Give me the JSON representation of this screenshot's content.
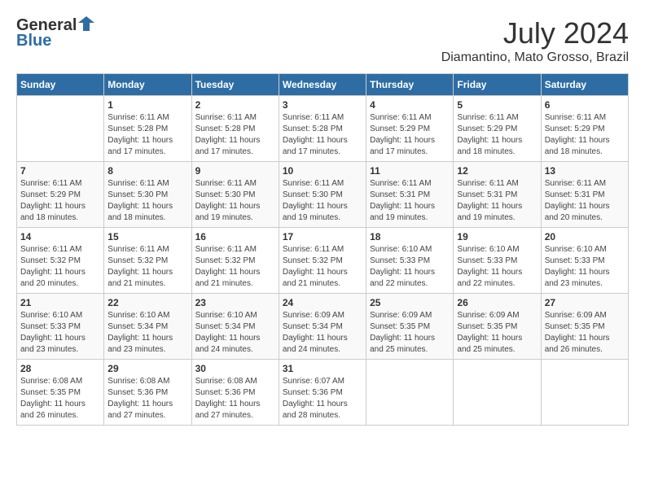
{
  "header": {
    "logo_general": "General",
    "logo_blue": "Blue",
    "month": "July 2024",
    "location": "Diamantino, Mato Grosso, Brazil"
  },
  "days_of_week": [
    "Sunday",
    "Monday",
    "Tuesday",
    "Wednesday",
    "Thursday",
    "Friday",
    "Saturday"
  ],
  "weeks": [
    [
      {
        "day": "",
        "info": ""
      },
      {
        "day": "1",
        "info": "Sunrise: 6:11 AM\nSunset: 5:28 PM\nDaylight: 11 hours\nand 17 minutes."
      },
      {
        "day": "2",
        "info": "Sunrise: 6:11 AM\nSunset: 5:28 PM\nDaylight: 11 hours\nand 17 minutes."
      },
      {
        "day": "3",
        "info": "Sunrise: 6:11 AM\nSunset: 5:28 PM\nDaylight: 11 hours\nand 17 minutes."
      },
      {
        "day": "4",
        "info": "Sunrise: 6:11 AM\nSunset: 5:29 PM\nDaylight: 11 hours\nand 17 minutes."
      },
      {
        "day": "5",
        "info": "Sunrise: 6:11 AM\nSunset: 5:29 PM\nDaylight: 11 hours\nand 18 minutes."
      },
      {
        "day": "6",
        "info": "Sunrise: 6:11 AM\nSunset: 5:29 PM\nDaylight: 11 hours\nand 18 minutes."
      }
    ],
    [
      {
        "day": "7",
        "info": "Sunrise: 6:11 AM\nSunset: 5:29 PM\nDaylight: 11 hours\nand 18 minutes."
      },
      {
        "day": "8",
        "info": "Sunrise: 6:11 AM\nSunset: 5:30 PM\nDaylight: 11 hours\nand 18 minutes."
      },
      {
        "day": "9",
        "info": "Sunrise: 6:11 AM\nSunset: 5:30 PM\nDaylight: 11 hours\nand 19 minutes."
      },
      {
        "day": "10",
        "info": "Sunrise: 6:11 AM\nSunset: 5:30 PM\nDaylight: 11 hours\nand 19 minutes."
      },
      {
        "day": "11",
        "info": "Sunrise: 6:11 AM\nSunset: 5:31 PM\nDaylight: 11 hours\nand 19 minutes."
      },
      {
        "day": "12",
        "info": "Sunrise: 6:11 AM\nSunset: 5:31 PM\nDaylight: 11 hours\nand 19 minutes."
      },
      {
        "day": "13",
        "info": "Sunrise: 6:11 AM\nSunset: 5:31 PM\nDaylight: 11 hours\nand 20 minutes."
      }
    ],
    [
      {
        "day": "14",
        "info": "Sunrise: 6:11 AM\nSunset: 5:32 PM\nDaylight: 11 hours\nand 20 minutes."
      },
      {
        "day": "15",
        "info": "Sunrise: 6:11 AM\nSunset: 5:32 PM\nDaylight: 11 hours\nand 21 minutes."
      },
      {
        "day": "16",
        "info": "Sunrise: 6:11 AM\nSunset: 5:32 PM\nDaylight: 11 hours\nand 21 minutes."
      },
      {
        "day": "17",
        "info": "Sunrise: 6:11 AM\nSunset: 5:32 PM\nDaylight: 11 hours\nand 21 minutes."
      },
      {
        "day": "18",
        "info": "Sunrise: 6:10 AM\nSunset: 5:33 PM\nDaylight: 11 hours\nand 22 minutes."
      },
      {
        "day": "19",
        "info": "Sunrise: 6:10 AM\nSunset: 5:33 PM\nDaylight: 11 hours\nand 22 minutes."
      },
      {
        "day": "20",
        "info": "Sunrise: 6:10 AM\nSunset: 5:33 PM\nDaylight: 11 hours\nand 23 minutes."
      }
    ],
    [
      {
        "day": "21",
        "info": "Sunrise: 6:10 AM\nSunset: 5:33 PM\nDaylight: 11 hours\nand 23 minutes."
      },
      {
        "day": "22",
        "info": "Sunrise: 6:10 AM\nSunset: 5:34 PM\nDaylight: 11 hours\nand 23 minutes."
      },
      {
        "day": "23",
        "info": "Sunrise: 6:10 AM\nSunset: 5:34 PM\nDaylight: 11 hours\nand 24 minutes."
      },
      {
        "day": "24",
        "info": "Sunrise: 6:09 AM\nSunset: 5:34 PM\nDaylight: 11 hours\nand 24 minutes."
      },
      {
        "day": "25",
        "info": "Sunrise: 6:09 AM\nSunset: 5:35 PM\nDaylight: 11 hours\nand 25 minutes."
      },
      {
        "day": "26",
        "info": "Sunrise: 6:09 AM\nSunset: 5:35 PM\nDaylight: 11 hours\nand 25 minutes."
      },
      {
        "day": "27",
        "info": "Sunrise: 6:09 AM\nSunset: 5:35 PM\nDaylight: 11 hours\nand 26 minutes."
      }
    ],
    [
      {
        "day": "28",
        "info": "Sunrise: 6:08 AM\nSunset: 5:35 PM\nDaylight: 11 hours\nand 26 minutes."
      },
      {
        "day": "29",
        "info": "Sunrise: 6:08 AM\nSunset: 5:36 PM\nDaylight: 11 hours\nand 27 minutes."
      },
      {
        "day": "30",
        "info": "Sunrise: 6:08 AM\nSunset: 5:36 PM\nDaylight: 11 hours\nand 27 minutes."
      },
      {
        "day": "31",
        "info": "Sunrise: 6:07 AM\nSunset: 5:36 PM\nDaylight: 11 hours\nand 28 minutes."
      },
      {
        "day": "",
        "info": ""
      },
      {
        "day": "",
        "info": ""
      },
      {
        "day": "",
        "info": ""
      }
    ]
  ]
}
